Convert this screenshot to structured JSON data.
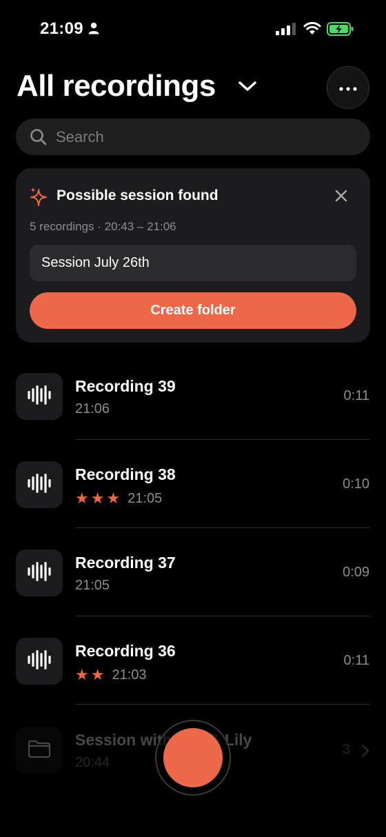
{
  "status_bar": {
    "time": "21:09",
    "icons": [
      "person-icon",
      "signal-icon",
      "wifi-icon",
      "battery-charging-icon"
    ]
  },
  "header": {
    "title": "All recordings",
    "dropdown_icon": "chevron-down-icon",
    "more_icon": "ellipsis-icon"
  },
  "search": {
    "placeholder": "Search",
    "value": ""
  },
  "session_card": {
    "icon": "sparkle-icon",
    "title": "Possible session found",
    "meta": "5 recordings · 20:43 – 21:06",
    "session_name": "Session July 26th",
    "create_label": "Create folder",
    "close_icon": "close-icon"
  },
  "recordings": [
    {
      "title": "Recording 39",
      "stars": "",
      "time": "21:06",
      "duration": "0:11"
    },
    {
      "title": "Recording 38",
      "stars": "★★★",
      "time": "21:05",
      "duration": "0:10"
    },
    {
      "title": "Recording 37",
      "stars": "",
      "time": "21:05",
      "duration": "0:09"
    },
    {
      "title": "Recording 36",
      "stars": "★★",
      "time": "21:03",
      "duration": "0:11"
    }
  ],
  "folder_row": {
    "title": "Session with Ava & Lily",
    "time": "20:44",
    "count": "3",
    "icon": "folder-icon"
  },
  "colors": {
    "accent": "#ec6849",
    "background": "#000000",
    "card": "#1c1c1e",
    "secondary_text": "#8d8d8f"
  }
}
